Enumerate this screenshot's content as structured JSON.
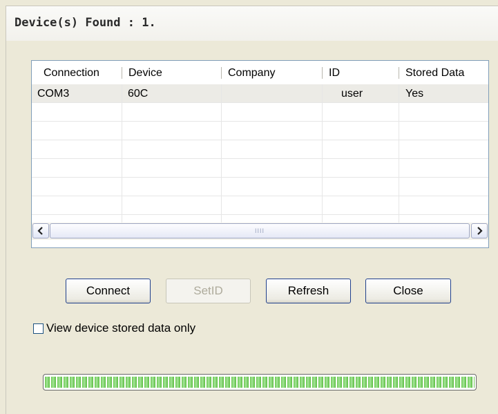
{
  "window": {
    "title": "Device(s) Found : 1."
  },
  "list": {
    "columns": [
      "Connection",
      "Device",
      "Company",
      "ID",
      "Stored Data"
    ],
    "rows": [
      [
        "COM3",
        "60C",
        "",
        "user",
        "Yes"
      ]
    ],
    "empty_row_count": 7
  },
  "scrollbar": {
    "left_arrow": "<",
    "right_arrow": ">",
    "grip": "IIII"
  },
  "buttons": {
    "connect": "Connect",
    "setid": "SetID",
    "refresh": "Refresh",
    "close": "Close"
  },
  "checkbox": {
    "label": "View device stored data only",
    "checked": false
  },
  "progress": {
    "value": 1.0,
    "color": "#5bbd40"
  },
  "colors": {
    "window_bg": "#ece9d8",
    "list_border": "#7f9db9",
    "button_border": "#1f3f8c"
  }
}
